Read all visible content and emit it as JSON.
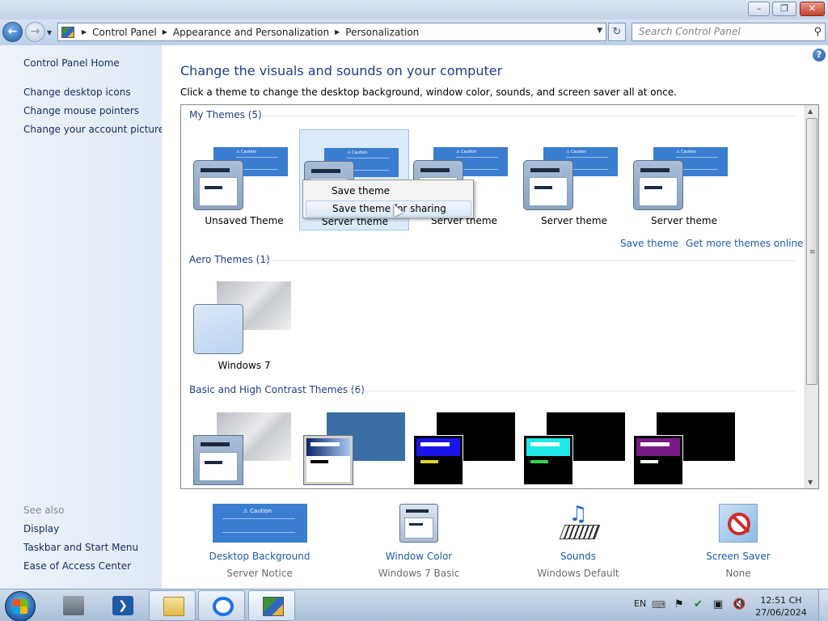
{
  "address_bar": {
    "breadcrumbs": [
      "Control Panel",
      "Appearance and Personalization",
      "Personalization"
    ],
    "search_placeholder": "Search Control Panel"
  },
  "sidebar": {
    "home": "Control Panel Home",
    "tasks": [
      "Change desktop icons",
      "Change mouse pointers",
      "Change your account picture"
    ],
    "see_also_header": "See also",
    "see_also": [
      "Display",
      "Taskbar and Start Menu",
      "Ease of Access Center"
    ]
  },
  "main": {
    "heading": "Change the visuals and sounds on your computer",
    "subtitle": "Click a theme to change the desktop background, window color, sounds, and screen saver all at once."
  },
  "themes": {
    "my_themes_header": "My Themes (5)",
    "my_themes": [
      "Unsaved Theme",
      "Server theme",
      "Server theme",
      "Server theme",
      "Server theme"
    ],
    "save_theme_link": "Save theme",
    "get_more_link": "Get more themes online",
    "aero_header": "Aero Themes (1)",
    "aero_themes": [
      "Windows 7"
    ],
    "basic_header": "Basic and High Contrast Themes (6)"
  },
  "context_menu": {
    "items": [
      "Save theme",
      "Save theme for sharing"
    ],
    "highlighted_index": 1
  },
  "bottom_settings": [
    {
      "label": "Desktop Background",
      "value": "Server Notice",
      "icon": "desktop-background-icon",
      "preview_title": "Caution"
    },
    {
      "label": "Window Color",
      "value": "Windows 7 Basic",
      "icon": "window-color-icon"
    },
    {
      "label": "Sounds",
      "value": "Windows Default",
      "icon": "sounds-icon"
    },
    {
      "label": "Screen Saver",
      "value": "None",
      "icon": "screen-saver-icon"
    }
  ],
  "taskbar": {
    "language": "EN",
    "time": "12:51 CH",
    "date": "27/06/2024"
  },
  "colors": {
    "link": "#1e5ab0",
    "heading": "#1e3d8a",
    "selected_tile": "#dcebfc"
  }
}
